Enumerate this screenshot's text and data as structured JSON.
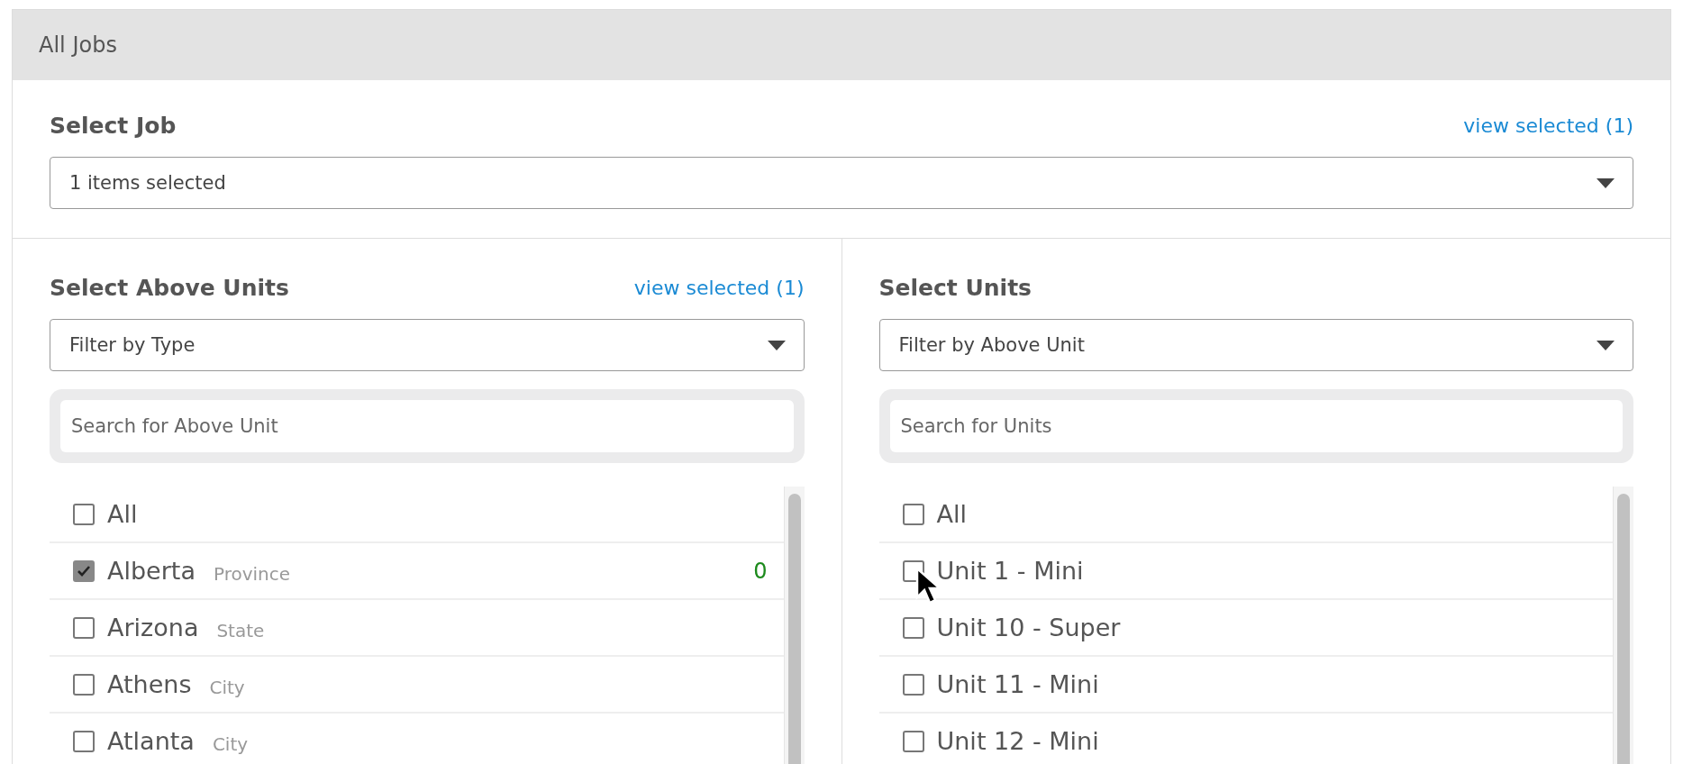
{
  "panel": {
    "title": "All Jobs"
  },
  "job": {
    "label": "Select Job",
    "link": "view selected (1)",
    "dropdown": "1 items selected"
  },
  "columns": [
    {
      "label": "Select Above Units",
      "link": "view selected (1)",
      "filter": "Filter by Type",
      "search_placeholder": "Search for Above Unit",
      "items": [
        {
          "name": "All",
          "checked": false
        },
        {
          "name": "Alberta",
          "type": "Province",
          "count": "0",
          "checked": true
        },
        {
          "name": "Arizona",
          "type": "State",
          "checked": false
        },
        {
          "name": "Athens",
          "type": "City",
          "checked": false
        },
        {
          "name": "Atlanta",
          "type": "City",
          "checked": false
        }
      ]
    },
    {
      "label": "Select Units",
      "filter": "Filter by Above Unit",
      "search_placeholder": "Search for Units",
      "items": [
        {
          "name": "All",
          "checked": false
        },
        {
          "name": "Unit 1 - Mini",
          "checked": false
        },
        {
          "name": "Unit 10 - Super",
          "checked": false
        },
        {
          "name": "Unit 11 - Mini",
          "checked": false
        },
        {
          "name": "Unit 12 - Mini",
          "checked": false
        }
      ]
    }
  ]
}
